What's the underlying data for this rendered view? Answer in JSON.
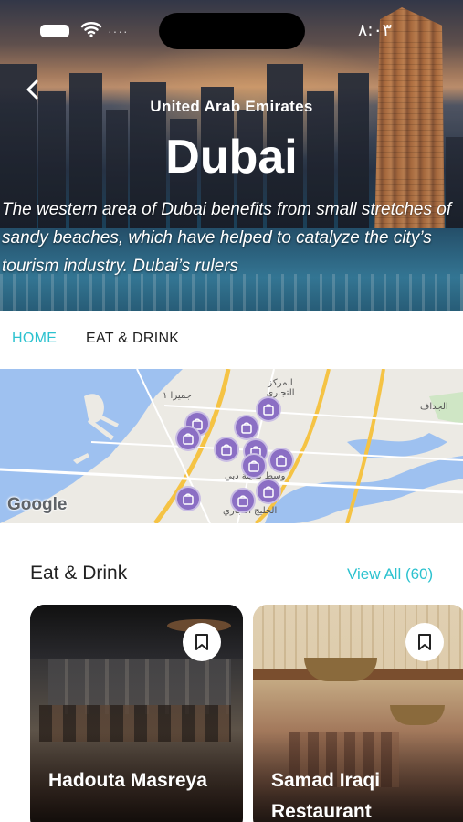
{
  "status": {
    "time": "٨:٠٣"
  },
  "hero": {
    "country": "United Arab Emirates",
    "city": "Dubai",
    "description": "The western area of Dubai benefits from small stretches of sandy beaches, which have helped to catalyze the city’s tourism industry. Dubai’s rulers"
  },
  "tabs": [
    {
      "label": "HOME",
      "active": true
    },
    {
      "label": "EAT & DRINK",
      "active": false
    }
  ],
  "map": {
    "attribution": "Google",
    "labels": [
      "جميرا ١",
      "المركز التجاري",
      "الجداف",
      "وسط مدينة دبي",
      "الخليج التجاري"
    ]
  },
  "section": {
    "title": "Eat & Drink",
    "view_all": "View All (60)"
  },
  "cards": [
    {
      "name": "Hadouta Masreya"
    },
    {
      "name": "Samad Iraqi Restaurant"
    }
  ],
  "colors": {
    "accent": "#2cc2cf",
    "pin": "#8b6fc4",
    "water": "#8ab4f8",
    "road": "#f5c344"
  }
}
